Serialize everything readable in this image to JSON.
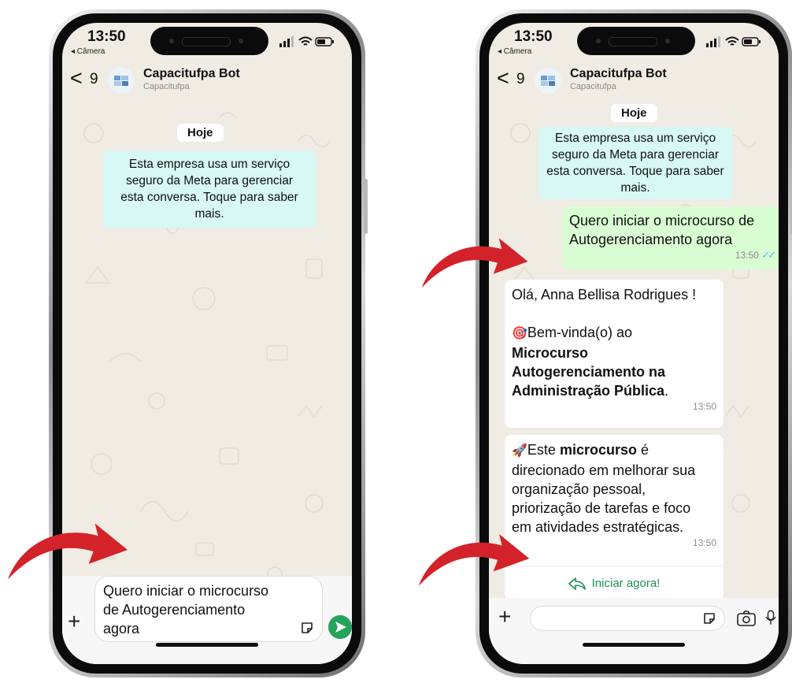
{
  "colors": {
    "chat_bg": "#f0ebe3",
    "outgoing": "#d9fdd3",
    "incoming": "#ffffff",
    "system": "#d7f8f4",
    "accent_green": "#25a35a",
    "arrow_red": "#d3222a"
  },
  "status": {
    "time": "13:50",
    "back_app": "◂ Câmera"
  },
  "header": {
    "back_glyph": "<",
    "unread": "9",
    "name": "Capacitufpa Bot",
    "subtitle": "Capacitufpa"
  },
  "date_label": "Hoje",
  "system_message": {
    "line1": "Esta empresa usa um serviço",
    "line2": "seguro da Meta para gerenciar",
    "line3": "esta conversa. Toque para saber",
    "line4": "mais."
  },
  "left_phone": {
    "draft_line1": "Quero iniciar o microcurso",
    "draft_line2": "de Autogerenciamento",
    "draft_line3": "agora"
  },
  "right_phone": {
    "outgoing": {
      "line1": "Quero iniciar o microcurso de",
      "line2": "Autogerenciamento agora",
      "time": "13:50"
    },
    "welcome": {
      "greeting": "Olá, Anna Bellisa Rodrigues !",
      "emoji_target": "🎯",
      "welcome_text": "Bem-vinda(o) ao",
      "bold1": "Microcurso",
      "bold2": "Autogerenciamento na",
      "bold3": "Administração Pública",
      "period": ".",
      "time": "13:50"
    },
    "info": {
      "emoji_rocket": "🚀",
      "text1": "Este ",
      "bold_word": "microcurso",
      "text1_end": " é",
      "line2": "direcionado em melhorar sua",
      "line3": "organização pessoal,",
      "line4": "priorização de tarefas e foco",
      "line5": "em atividades estratégicas.",
      "time": "13:50"
    },
    "cta_label": "Iniciar agora!"
  },
  "icons": {
    "plus": "+",
    "sticker": "sticker-icon",
    "send": "send-icon",
    "camera": "camera-icon",
    "mic": "microphone-icon",
    "reply": "reply-arrow-icon"
  }
}
